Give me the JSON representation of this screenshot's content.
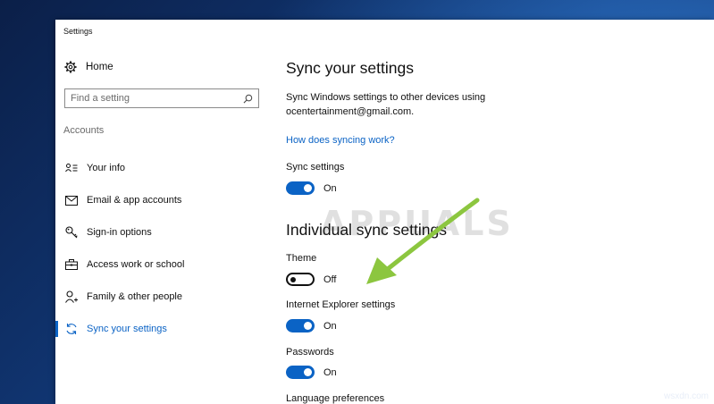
{
  "window": {
    "title": "Settings"
  },
  "sidebar": {
    "home_label": "Home",
    "search_placeholder": "Find a setting",
    "section_label": "Accounts",
    "items": [
      {
        "label": "Your info",
        "icon": "person-card-icon"
      },
      {
        "label": "Email & app accounts",
        "icon": "mail-icon"
      },
      {
        "label": "Sign-in options",
        "icon": "key-icon"
      },
      {
        "label": "Access work or school",
        "icon": "briefcase-icon"
      },
      {
        "label": "Family & other people",
        "icon": "person-add-icon"
      },
      {
        "label": "Sync your settings",
        "icon": "sync-icon",
        "active": true
      }
    ]
  },
  "main": {
    "title": "Sync your settings",
    "description": "Sync Windows settings to other devices using ocentertainment@gmail.com.",
    "link": "How does syncing work?",
    "sync_settings": {
      "label": "Sync settings",
      "state": "On"
    },
    "individual_title": "Individual sync settings",
    "individual": [
      {
        "label": "Theme",
        "state": "Off"
      },
      {
        "label": "Internet Explorer settings",
        "state": "On"
      },
      {
        "label": "Passwords",
        "state": "On"
      },
      {
        "label": "Language preferences"
      }
    ]
  },
  "overlay": {
    "watermark": "APPUALS",
    "site_label": "wsxdn.com"
  },
  "colors": {
    "accent": "#0b63c5",
    "arrow": "#8cc63f"
  }
}
